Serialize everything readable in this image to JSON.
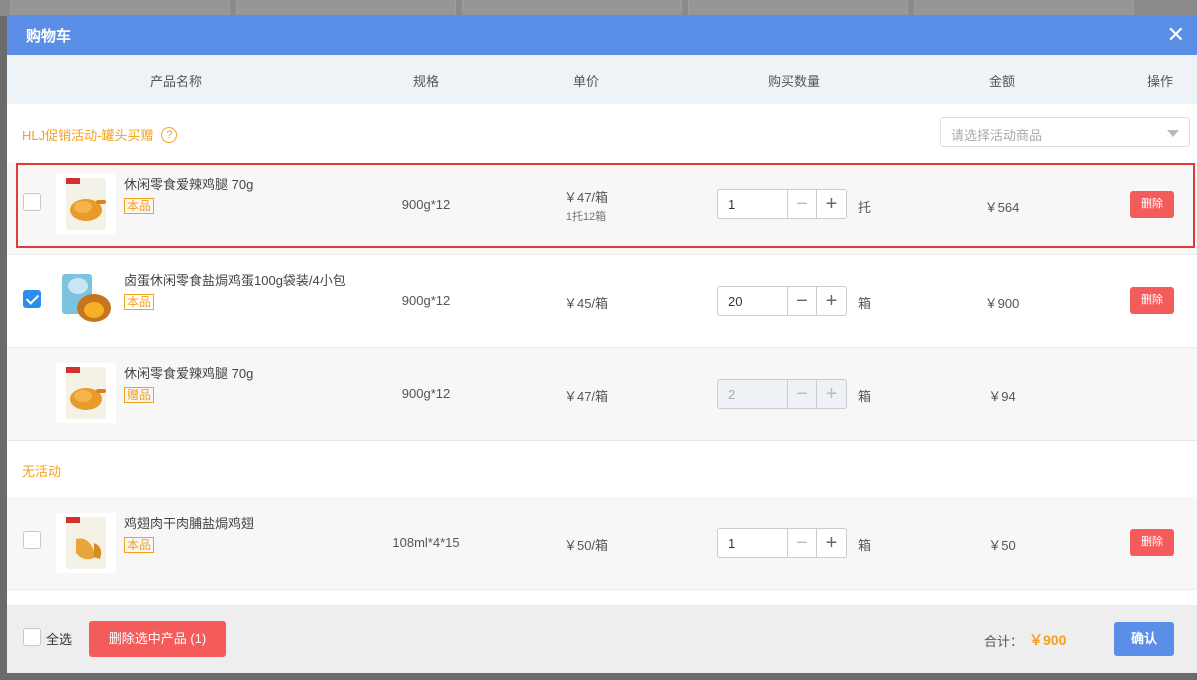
{
  "modal": {
    "title": "购物车",
    "close_icon": "close-icon"
  },
  "columns": [
    "产品名称",
    "规格",
    "单价",
    "购买数量",
    "金额",
    "操作"
  ],
  "groups": [
    {
      "title": "HLJ促销活动-罐头买赠",
      "help_icon": "?",
      "select_placeholder": "请选择活动商品",
      "rows": [
        {
          "name": "休闲零食爱辣鸡腿 70g",
          "tag": "本品",
          "spec": "900g*12",
          "price": "￥47/箱",
          "price_sub": "1托12箱",
          "qty": "1",
          "unit": "托",
          "amount": "￥564",
          "checked": false,
          "delete": "删除",
          "disabled": false,
          "highlight": true
        },
        {
          "name": "卤蛋休闲零食盐焗鸡蛋100g袋装/4小包",
          "tag": "本品",
          "spec": "900g*12",
          "price": "￥45/箱",
          "qty": "20",
          "unit": "箱",
          "amount": "￥900",
          "checked": true,
          "delete": "删除",
          "disabled": false
        },
        {
          "name": "休闲零食爱辣鸡腿 70g",
          "tag": "赠品",
          "spec": "900g*12",
          "price": "￥47/箱",
          "qty": "2",
          "unit": "箱",
          "amount": "￥94",
          "disabled": true
        }
      ]
    },
    {
      "title": "无活动",
      "rows": [
        {
          "name": "鸡翅肉干肉脯盐焗鸡翅",
          "tag": "本品",
          "spec": "108ml*4*15",
          "price": "￥50/箱",
          "qty": "1",
          "unit": "箱",
          "amount": "￥50",
          "checked": false,
          "delete": "删除",
          "disabled": false
        }
      ]
    }
  ],
  "footer": {
    "select_all": "全选",
    "bulk_delete": "删除选中产品 (1)",
    "total_label": "合计：",
    "total_value": "￥900",
    "confirm": "确认"
  },
  "colors": {
    "header": "#5b8ee6",
    "accent": "#f5a01c",
    "danger": "#f45c5c",
    "check": "#2d8cf0"
  }
}
